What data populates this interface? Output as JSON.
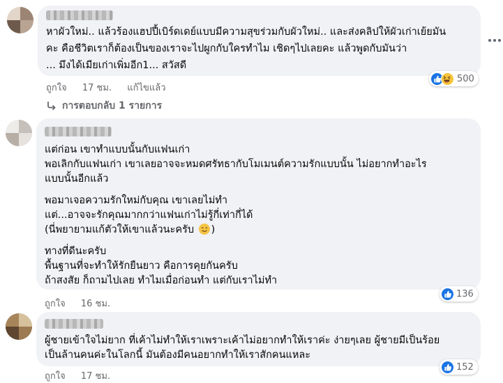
{
  "comments": [
    {
      "lines": [
        "หาผัวใหม่.. แล้วร้องแฮปปี้เบิร์ดเดย์แบบมีความสุขร่วมกับผัวใหม่.. และส่งคลิปให้ผัวเก่าเย้ยมัน",
        "คะ คือชีวิตเราก็ต้องเป็นของเราจะไปผูกกับใครทำไม เชิดๆไปเลยคะ แล้วพูดกับมันว่า",
        "... มึงได้เมียเก่าเพิ่มอีก1... สวัสดี"
      ],
      "like_label": "ถูกใจ",
      "time": "17 ชม.",
      "edited_label": "แก้ไขแล้ว",
      "reaction_count": "500",
      "replies_label": "การตอบกลับ 1 รายการ"
    },
    {
      "para1": [
        "แต่ก่อน เขาทำแบบนั้นกับแฟนเก่า",
        "พอเลิกกับแฟนเก่า เขาเลยอาจจะหมดศรัทธากับโมเมนต์ความรักแบบนั้น ไม่อยากทำอะไร",
        "แบบนั้นอีกแล้ว"
      ],
      "para2": [
        "พอมาเจอความรักใหม่กับคุณ เขาเลยไม่ทำ",
        "แต่...อาจจะรักคุณมากกว่าแฟนเก่าไม่รู้กี่เท่ากี่ได้",
        "(นี่พยายามแก้ตัวให้เขาแล้วนะครับ"
      ],
      "para3": [
        "ทางที่ดีนะครับ",
        "พื้นฐานที่จะทำให้รักยืนยาว คือการคุยกันครับ",
        "ถ้าสงสัย ก็ถามไปเลย ทำไมเมื่อก่อนทำ แต่กับเราไม่ทำ"
      ],
      "like_label": "ถูกใจ",
      "time": "16 ชม.",
      "reaction_count": "136"
    },
    {
      "lines": [
        "ผู้ชายเข้าใจไม่ยาก ที่เค้าไม่ทำให้เราเพราะเค้าไม่อยากทำให้เราค่ะ ง่ายๆเลย ผู้ชายมีเป็นร้อย",
        "เป็นล้านคนค่ะในโลกนี้ มันต้องมีคนอยากทำให้เราสักคนแหละ"
      ],
      "like_label": "ถูกใจ",
      "time": "17 ชม.",
      "reaction_count": "152"
    }
  ],
  "colors": {
    "bubble": "#f0f2f5",
    "meta": "#65676b",
    "like_blue": "#1b74e4"
  },
  "icons": [
    "like-icon",
    "haha-icon",
    "reply-arrow-icon",
    "more-options-icon",
    "smile-emoji-icon"
  ]
}
